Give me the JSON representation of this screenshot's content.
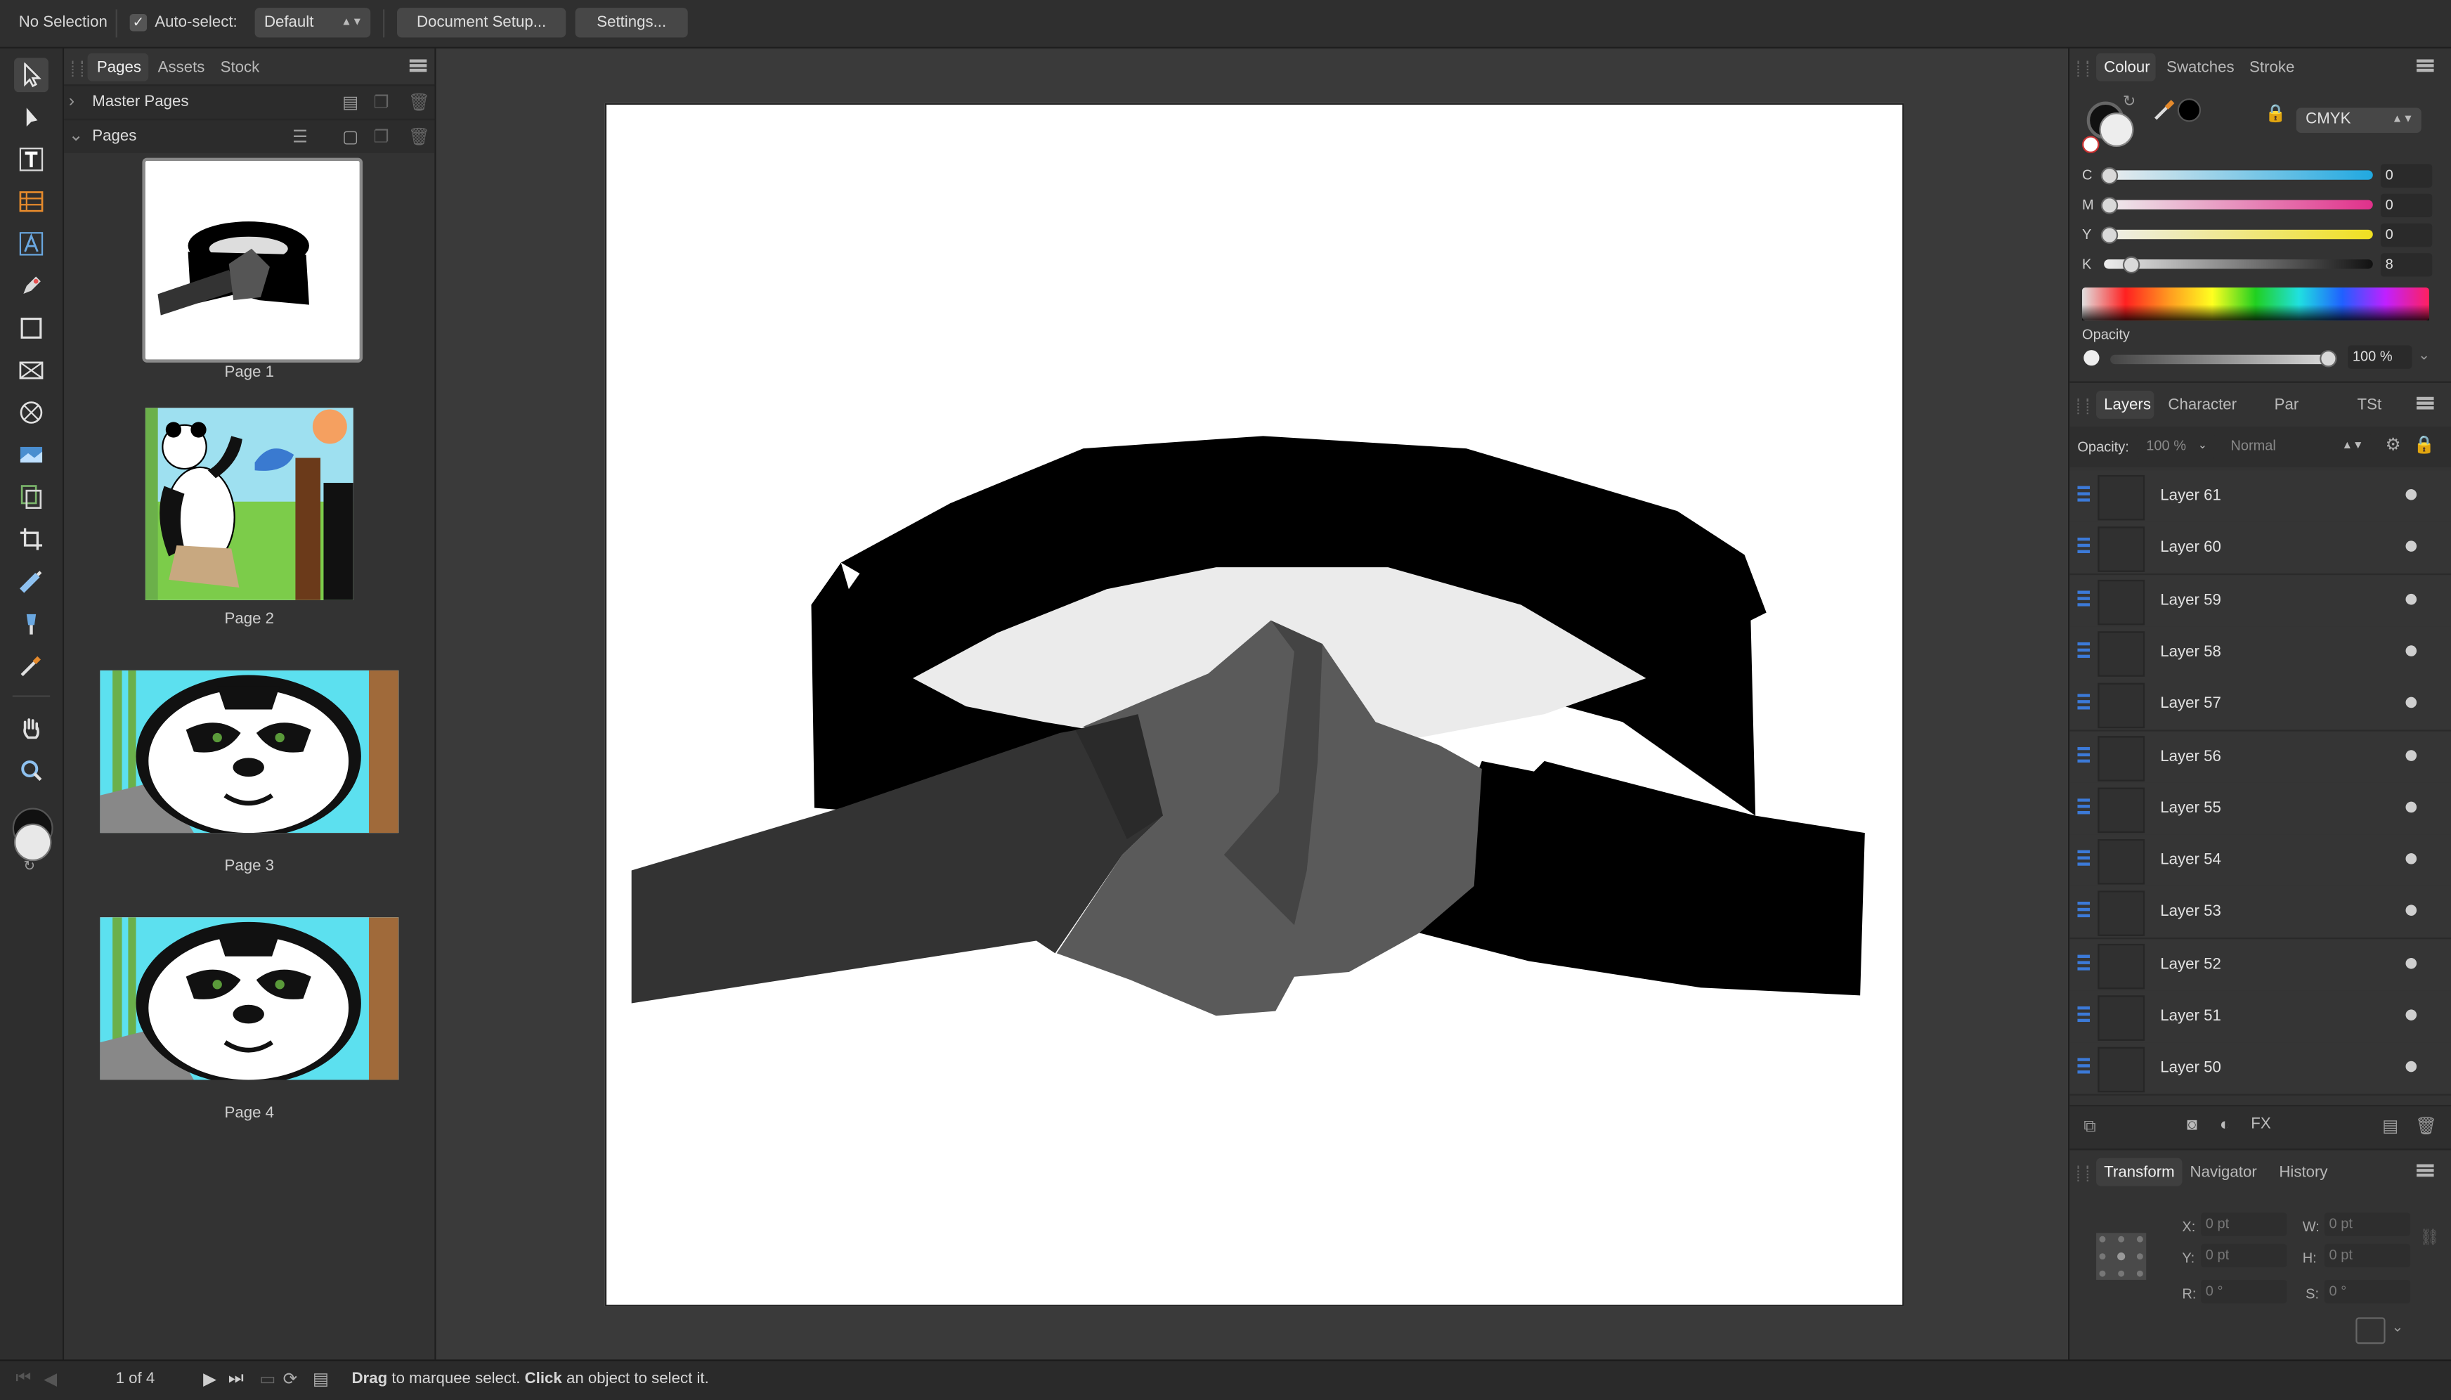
{
  "toolbar": {
    "selection_status": "No Selection",
    "auto_select_label": "Auto-select:",
    "auto_select_value": "Default",
    "document_setup_label": "Document Setup...",
    "settings_label": "Settings..."
  },
  "left_panel": {
    "tabs": [
      "Pages",
      "Assets",
      "Stock"
    ],
    "master_pages_label": "Master Pages",
    "pages_label": "Pages",
    "pages": [
      {
        "label": "Page 1"
      },
      {
        "label": "Page 2"
      },
      {
        "label": "Page 3"
      },
      {
        "label": "Page 4"
      }
    ]
  },
  "colour_panel": {
    "tabs": [
      "Colour",
      "Swatches",
      "Stroke"
    ],
    "model": "CMYK",
    "channels": [
      {
        "name": "C",
        "value": "0",
        "level": 0,
        "color": "#20a8e0"
      },
      {
        "name": "M",
        "value": "0",
        "level": 0,
        "color": "#e0308a"
      },
      {
        "name": "Y",
        "value": "0",
        "level": 0,
        "color": "#f0e020"
      },
      {
        "name": "K",
        "value": "8",
        "level": 0.08,
        "color": "#111111"
      }
    ],
    "opacity_label": "Opacity",
    "opacity_value": "100 %"
  },
  "layers_panel": {
    "tabs": [
      "Layers",
      "Character",
      "Par",
      "TSt"
    ],
    "opacity_label": "Opacity:",
    "opacity_value": "100 %",
    "blend_mode": "Normal",
    "layers": [
      {
        "name": "Layer 61"
      },
      {
        "name": "Layer 60"
      },
      {
        "name": "Layer 59"
      },
      {
        "name": "Layer 58"
      },
      {
        "name": "Layer 57"
      },
      {
        "name": "Layer 56"
      },
      {
        "name": "Layer 55"
      },
      {
        "name": "Layer 54"
      },
      {
        "name": "Layer 53"
      },
      {
        "name": "Layer 52"
      },
      {
        "name": "Layer 51"
      },
      {
        "name": "Layer 50"
      }
    ]
  },
  "transform_panel": {
    "tabs": [
      "Transform",
      "Navigator",
      "History"
    ],
    "x_label": "X:",
    "x_value": "0 pt",
    "y_label": "Y:",
    "y_value": "0 pt",
    "w_label": "W:",
    "w_value": "0 pt",
    "h_label": "H:",
    "h_value": "0 pt",
    "r_label": "R:",
    "r_value": "0 °",
    "s_label": "S:",
    "s_value": "0 °"
  },
  "status_bar": {
    "page_indicator": "1 of 4",
    "hint_bold_1": "Drag",
    "hint_text_1": " to marquee select. ",
    "hint_bold_2": "Click",
    "hint_text_2": " an object to select it."
  }
}
